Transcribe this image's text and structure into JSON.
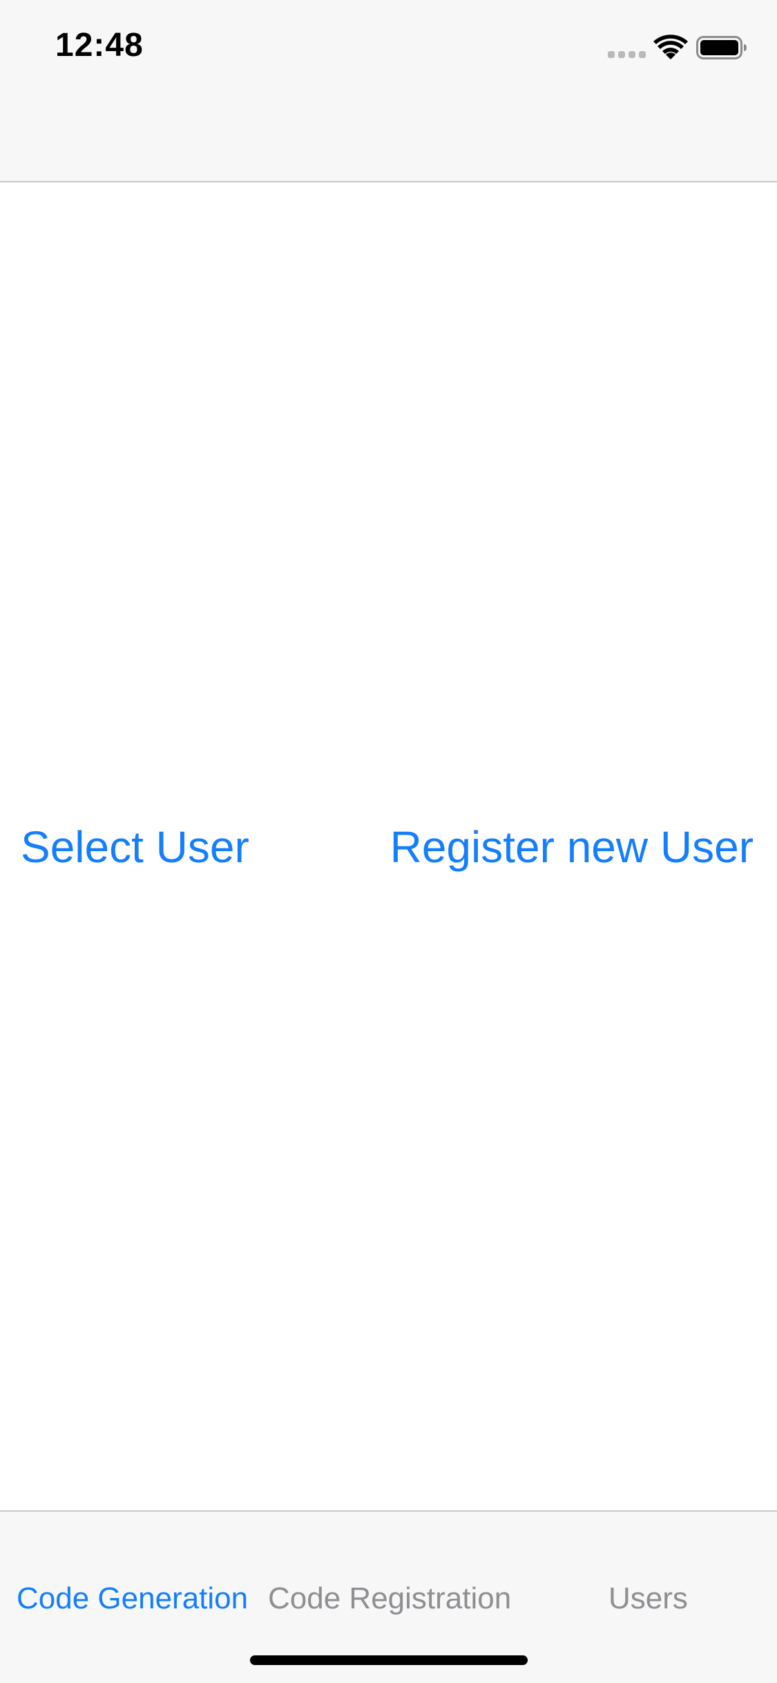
{
  "status_bar": {
    "time": "12:48"
  },
  "main": {
    "select_user_label": "Select User",
    "register_user_label": "Register new User"
  },
  "tab_bar": {
    "tabs": [
      {
        "label": "Code Generation",
        "active": true
      },
      {
        "label": "Code Registration",
        "active": false
      },
      {
        "label": "Users",
        "active": false
      }
    ]
  },
  "colors": {
    "accent": "#147efb",
    "inactive_tab": "#8e8e93",
    "bar_background": "#f7f7f7"
  },
  "icons": [
    "signal-icon",
    "wifi-icon",
    "battery-icon"
  ]
}
